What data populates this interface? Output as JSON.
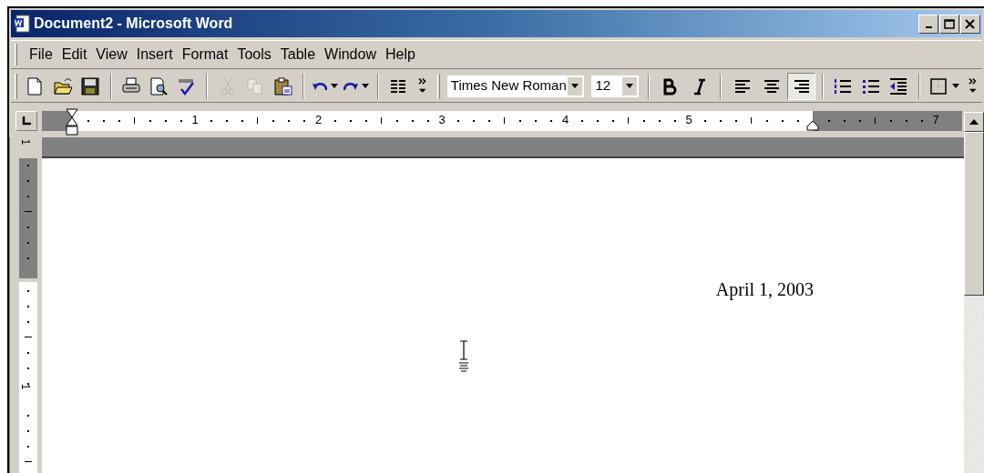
{
  "window": {
    "title": "Document2 - Microsoft Word",
    "controls": [
      {
        "kind": "minimize"
      },
      {
        "kind": "maximize"
      },
      {
        "kind": "close"
      }
    ]
  },
  "menu": [
    "File",
    "Edit",
    "View",
    "Insert",
    "Format",
    "Tools",
    "Table",
    "Window",
    "Help"
  ],
  "toolbar": [
    {
      "kind": "button",
      "disabled": false
    },
    {
      "kind": "button",
      "disabled": false
    },
    {
      "kind": "button",
      "disabled": false
    },
    {
      "kind": "separator"
    },
    {
      "kind": "button",
      "disabled": false
    },
    {
      "kind": "button",
      "disabled": false
    },
    {
      "kind": "button",
      "disabled": false
    },
    {
      "kind": "separator"
    },
    {
      "kind": "button",
      "disabled": true
    },
    {
      "kind": "button",
      "disabled": true
    },
    {
      "kind": "button",
      "disabled": false
    },
    {
      "kind": "separator"
    },
    {
      "kind": "split",
      "disabled": false
    },
    {
      "kind": "split",
      "disabled": false
    },
    {
      "kind": "separator"
    },
    {
      "kind": "button",
      "disabled": false
    },
    {
      "kind": "overflow"
    },
    {
      "kind": "grip"
    },
    {
      "kind": "combo",
      "value": "Times New Roman"
    },
    {
      "kind": "combo",
      "value": "12"
    },
    {
      "kind": "separator"
    },
    {
      "kind": "toggle",
      "selected": false
    },
    {
      "kind": "toggle",
      "selected": false
    },
    {
      "kind": "separator"
    },
    {
      "kind": "toggle",
      "selected": false
    },
    {
      "kind": "toggle",
      "selected": false
    },
    {
      "kind": "toggle",
      "selected": true
    },
    {
      "kind": "separator"
    },
    {
      "kind": "button",
      "disabled": false
    },
    {
      "kind": "button",
      "disabled": false
    },
    {
      "kind": "button",
      "disabled": false
    },
    {
      "kind": "separator"
    },
    {
      "kind": "split",
      "disabled": false
    },
    {
      "kind": "overflow"
    }
  ],
  "ruler": {
    "marks": [
      {
        "kind": "number",
        "label": "1"
      },
      {
        "kind": "number",
        "label": "2"
      },
      {
        "kind": "number",
        "label": "3"
      },
      {
        "kind": "number",
        "label": "4"
      },
      {
        "kind": "number",
        "label": "5"
      },
      {
        "kind": "right-indent"
      },
      {
        "kind": "number",
        "label": "7"
      }
    ]
  },
  "vertical_ruler": [
    "1",
    "1"
  ],
  "document": {
    "paragraphs": [
      "April 1, 2003"
    ]
  }
}
